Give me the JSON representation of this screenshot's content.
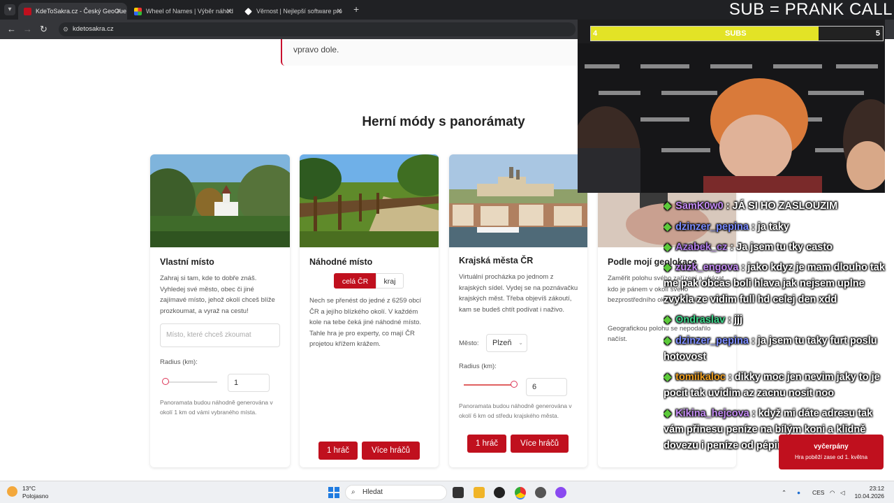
{
  "browser": {
    "tabs": [
      {
        "title": "KdeToSakra.cz - Český GeoGue",
        "active": true
      },
      {
        "title": "Wheel of Names | Výběr náhod",
        "active": false
      },
      {
        "title": "Věrnost | Nejlepší software pro",
        "active": false
      }
    ],
    "url": "kdetosakra.cz"
  },
  "overlay": {
    "banner": "SUB = PRANK CALL",
    "bar": {
      "left": "4",
      "center": "SUBS",
      "right": "5",
      "progress": 0.78
    },
    "chat": [
      {
        "user": "SamK0w0",
        "user_color": "#c58cf5",
        "text": ": JÁ SI HO ZASLOUZIM"
      },
      {
        "user": "dzinzer_pepina",
        "user_color": "#7b8cff",
        "text": ": ja taky"
      },
      {
        "user": "Azabek_cz",
        "user_color": "#b07ce8",
        "text": ": Ja jsem tu tky casto"
      },
      {
        "user": "zuzk_engova",
        "user_color": "#c58cf5",
        "text": ": jako kdyz je mam dlouho tak me pak obcas boli hlava jak nejsem uplne zvykla ze vidim full hd celej den xdd"
      },
      {
        "user": "Ondraslav",
        "user_color": "#3dd68a",
        "text": ": jjj"
      },
      {
        "user": "dzinzer_pepina",
        "user_color": "#7b8cff",
        "text": ": ja jsem tu taky furt poslu hotovost"
      },
      {
        "user": "tomiikaloc",
        "user_color": "#f0a020",
        "text": ": dikky moc jen nevim jaky to je pocit tak uvidim az zacnu nosit noo"
      },
      {
        "user": "Kikina_hejcova",
        "user_color": "#c58cf5",
        "text": ": když mi dáte adresu tak vám přinesu peníze na bílým koni a klidně dovezu i peníze od pépiny"
      }
    ],
    "toast": {
      "title": "vyčerpány",
      "subtitle": "Hra poběží zase od 1. května"
    }
  },
  "page": {
    "callout_text": "vpravo dole.",
    "section_title": "Herní módy s panorámaty",
    "cards": {
      "c1": {
        "title": "Vlastní místo",
        "desc": "Zahraj si tam, kde to dobře znáš. Vyhledej své město, obec či jiné zajímavé místo, jehož okolí chceš blíže prozkoumat, a vyraž na cestu!",
        "place_placeholder": "Místo, které chceš zkoumat",
        "radius_label": "Radius (km):",
        "radius_value": "1",
        "radius_fraction": 0.0,
        "note": "Panoramata budou náhodně generována v okolí 1 km od vámi vybraného místa."
      },
      "c2": {
        "title": "Náhodné místo",
        "toggle": [
          "celá ČR",
          "kraj"
        ],
        "toggle_selected": "celá ČR",
        "desc": "Nech se přenést do jedné z 6259 obcí ČR a jejího blízkého okolí. V každém kole na tebe čeká jiné náhodné místo. Tahle hra je pro experty, co mají ČR projetou křížem krážem.",
        "btn_single": "1 hráč",
        "btn_multi": "Více hráčů"
      },
      "c3": {
        "title": "Krajská města ČR",
        "desc": "Virtuální procházka po jednom z krajských sídel. Vydej se na poznávačku krajských měst. Třeba objevíš zákoutí, kam se budeš chtít podívat i naživo.",
        "city_label": "Město:",
        "city_value": "Plzeň",
        "radius_label": "Radius (km):",
        "radius_value": "6",
        "radius_fraction": 1.0,
        "note": "Panoramata budou náhodně generována v okolí 6 km od středu krajského města.",
        "btn_single": "1 hráč",
        "btn_multi": "Více hráčů"
      },
      "c4": {
        "title": "Podle mojí geolokace",
        "desc": "Zaměřit polohu svého zařízení a ukázat, kdo je pánem v okolí svého bezprostředního okolí. Jako plán!",
        "note": "Geografickou polohu se nepodařilo načíst."
      }
    }
  },
  "taskbar": {
    "weather_temp": "13°C",
    "weather_desc": "Polojasno",
    "search": "Hledat",
    "lang": "CES",
    "time": "23:12",
    "date": "10.04.2026"
  }
}
